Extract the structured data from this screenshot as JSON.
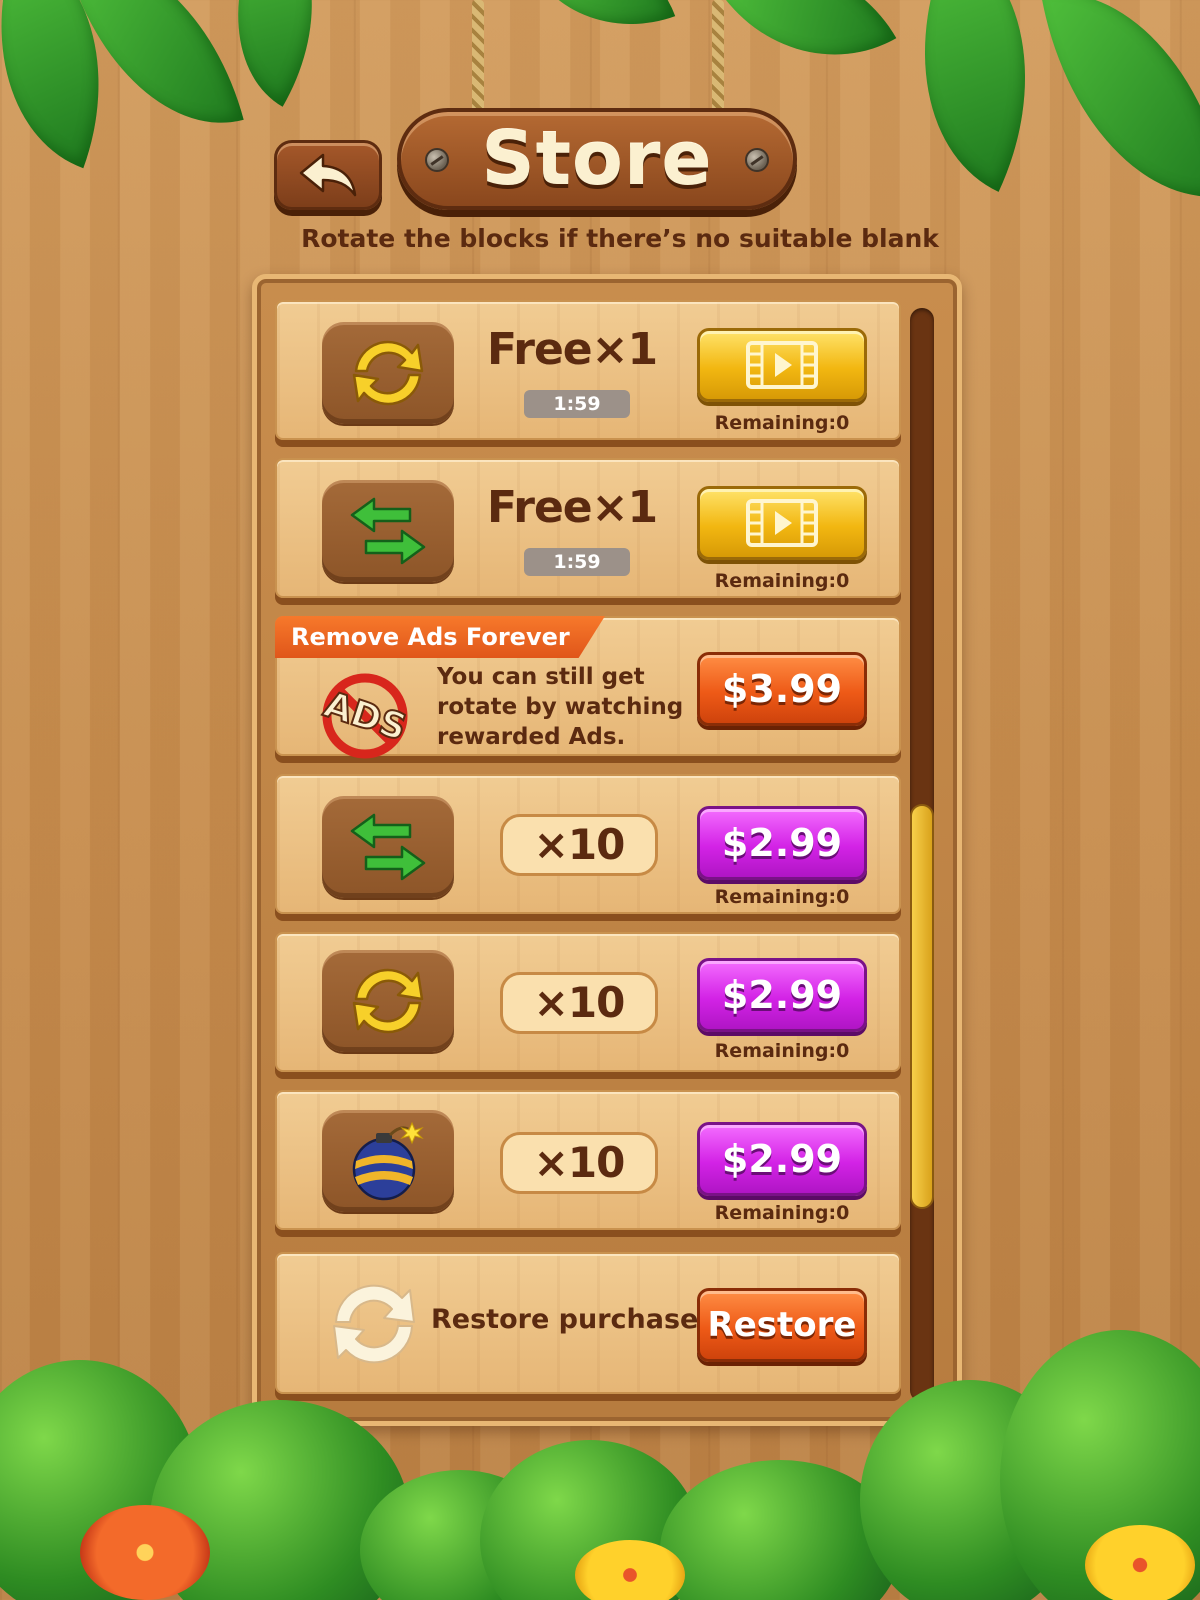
{
  "header": {
    "title": "Store",
    "subtitle": "Rotate the blocks if there’s no suitable blank",
    "back_icon": "back-arrow-icon"
  },
  "scrollbar": {
    "position": 0.72,
    "visible_fraction": 0.37
  },
  "items": [
    {
      "icon": "rotate-icon",
      "offer_text": "Free×1",
      "timer": "1:59",
      "button_icon": "video-icon",
      "remaining": "Remaining:0"
    },
    {
      "icon": "swap-icon",
      "offer_text": "Free×1",
      "timer": "1:59",
      "button_icon": "video-icon",
      "remaining": "Remaining:0"
    },
    {
      "ribbon": "Remove Ads Forever",
      "icon": "no-ads-icon",
      "icon_text": "ADS",
      "description": "You can still get rotate by watching rewarded Ads.",
      "price": "$3.99"
    },
    {
      "icon": "swap-icon",
      "quantity": "×10",
      "price": "$2.99",
      "remaining": "Remaining:0"
    },
    {
      "icon": "rotate-icon",
      "quantity": "×10",
      "price": "$2.99",
      "remaining": "Remaining:0"
    },
    {
      "icon": "bomb-icon",
      "quantity": "×10",
      "price": "$2.99",
      "remaining": "Remaining:0"
    }
  ],
  "restore": {
    "icon": "restore-icon",
    "label": "Restore purchase",
    "button": "Restore"
  },
  "colors": {
    "text_brown": "#5b2a10",
    "video_button": "#f2b711",
    "purple_button": "#d323e6",
    "orange_button": "#ee5a17"
  }
}
